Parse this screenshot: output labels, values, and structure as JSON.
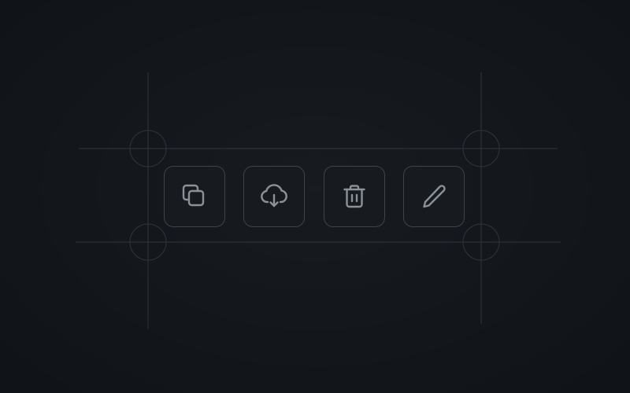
{
  "theme": {
    "background": "#13171c",
    "button_border": "#3d444c",
    "button_fill": "#171b20",
    "icon_stroke": "#8b9198",
    "guide_line": "#2a3037"
  },
  "toolbar": {
    "buttons": [
      {
        "id": "copy",
        "icon": "copy-icon",
        "label": ""
      },
      {
        "id": "download",
        "icon": "cloud-download-icon",
        "label": ""
      },
      {
        "id": "delete",
        "icon": "trash-icon",
        "label": ""
      },
      {
        "id": "edit",
        "icon": "pencil-icon",
        "label": ""
      }
    ]
  }
}
